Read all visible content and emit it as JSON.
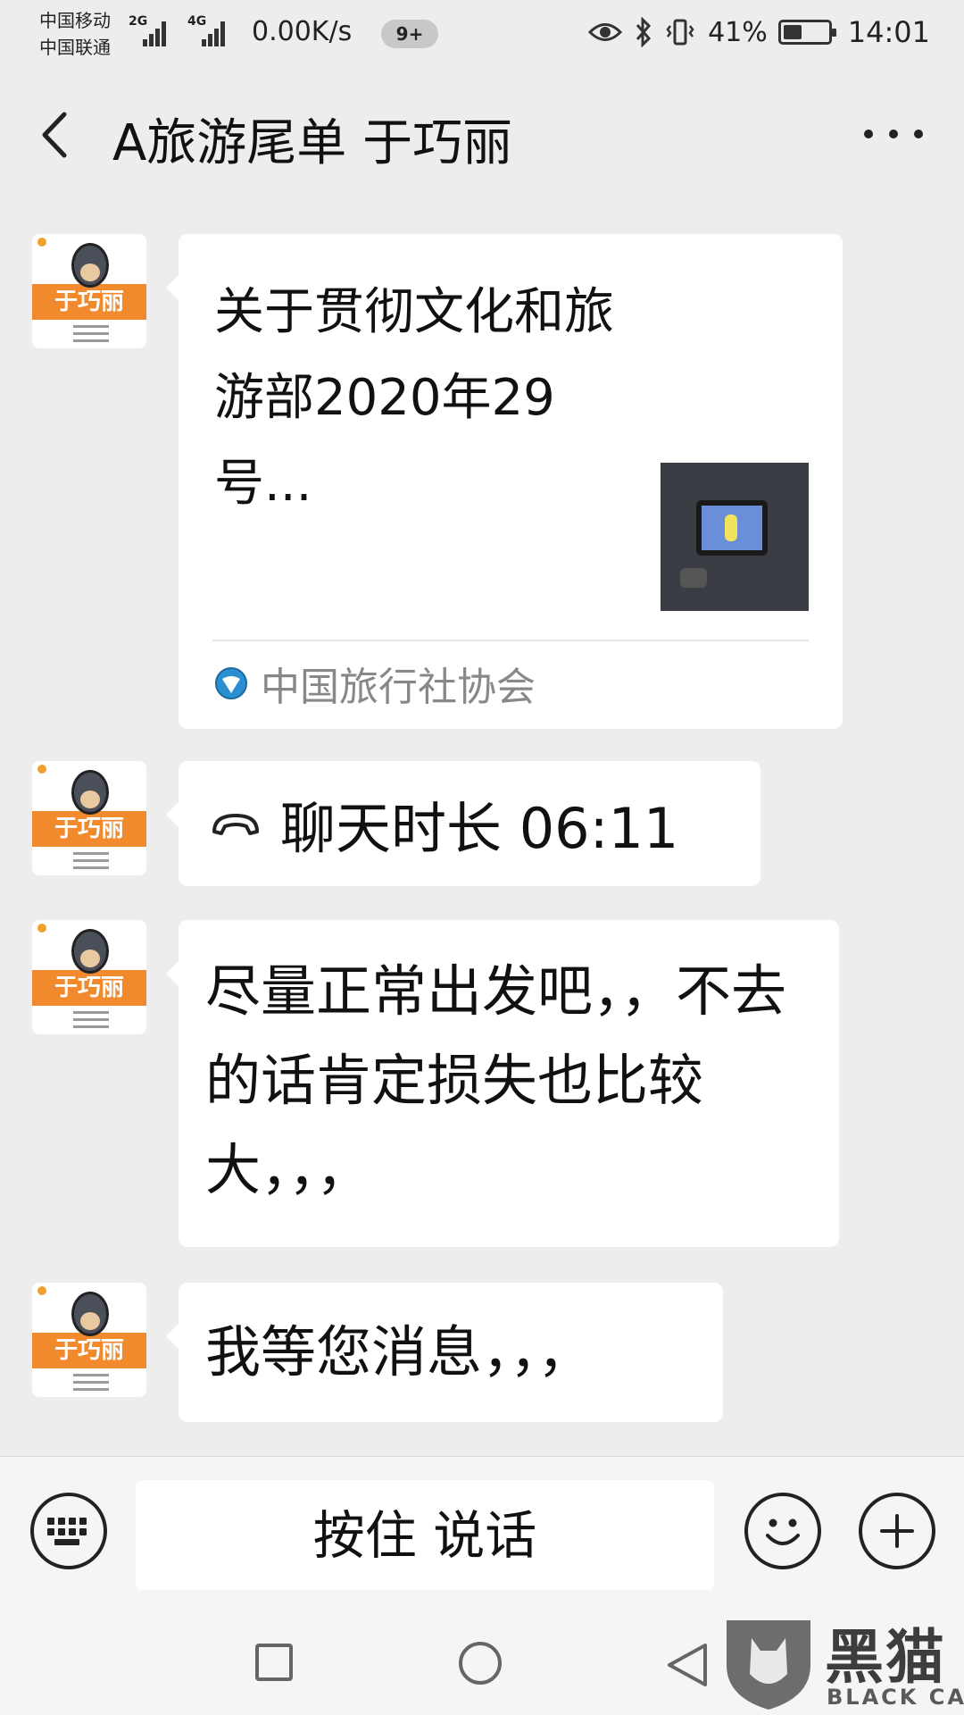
{
  "status_bar": {
    "carrier_1": "中国移动",
    "carrier_2": "中国联通",
    "sim1_tag": "2G",
    "sim2_tag": "4G",
    "net_speed": "0.00K/s",
    "notification_badge": "9+",
    "battery_percent": "41%",
    "battery_level": 0.41,
    "time": "14:01"
  },
  "header": {
    "title": "A旅游尾单 于巧丽"
  },
  "contact": {
    "avatar_label": "于巧丽"
  },
  "messages": {
    "link_card": {
      "title": "关于贯彻文化和旅游部2020年29号...",
      "source": "中国旅行社协会"
    },
    "call": {
      "text": "聊天时长 06:11"
    },
    "text_1": "尽量正常出发吧，，不去的话肯定损失也比较大，，，",
    "text_2": "我等您消息，，，"
  },
  "input_bar": {
    "hold_to_talk": "按住 说话"
  },
  "watermark": {
    "cn": "黑猫",
    "en": "BLACK CAT"
  },
  "colors": {
    "background": "#ededed",
    "bubble": "#ffffff",
    "avatar_band": "#f08a2c",
    "source_text": "#888888"
  }
}
